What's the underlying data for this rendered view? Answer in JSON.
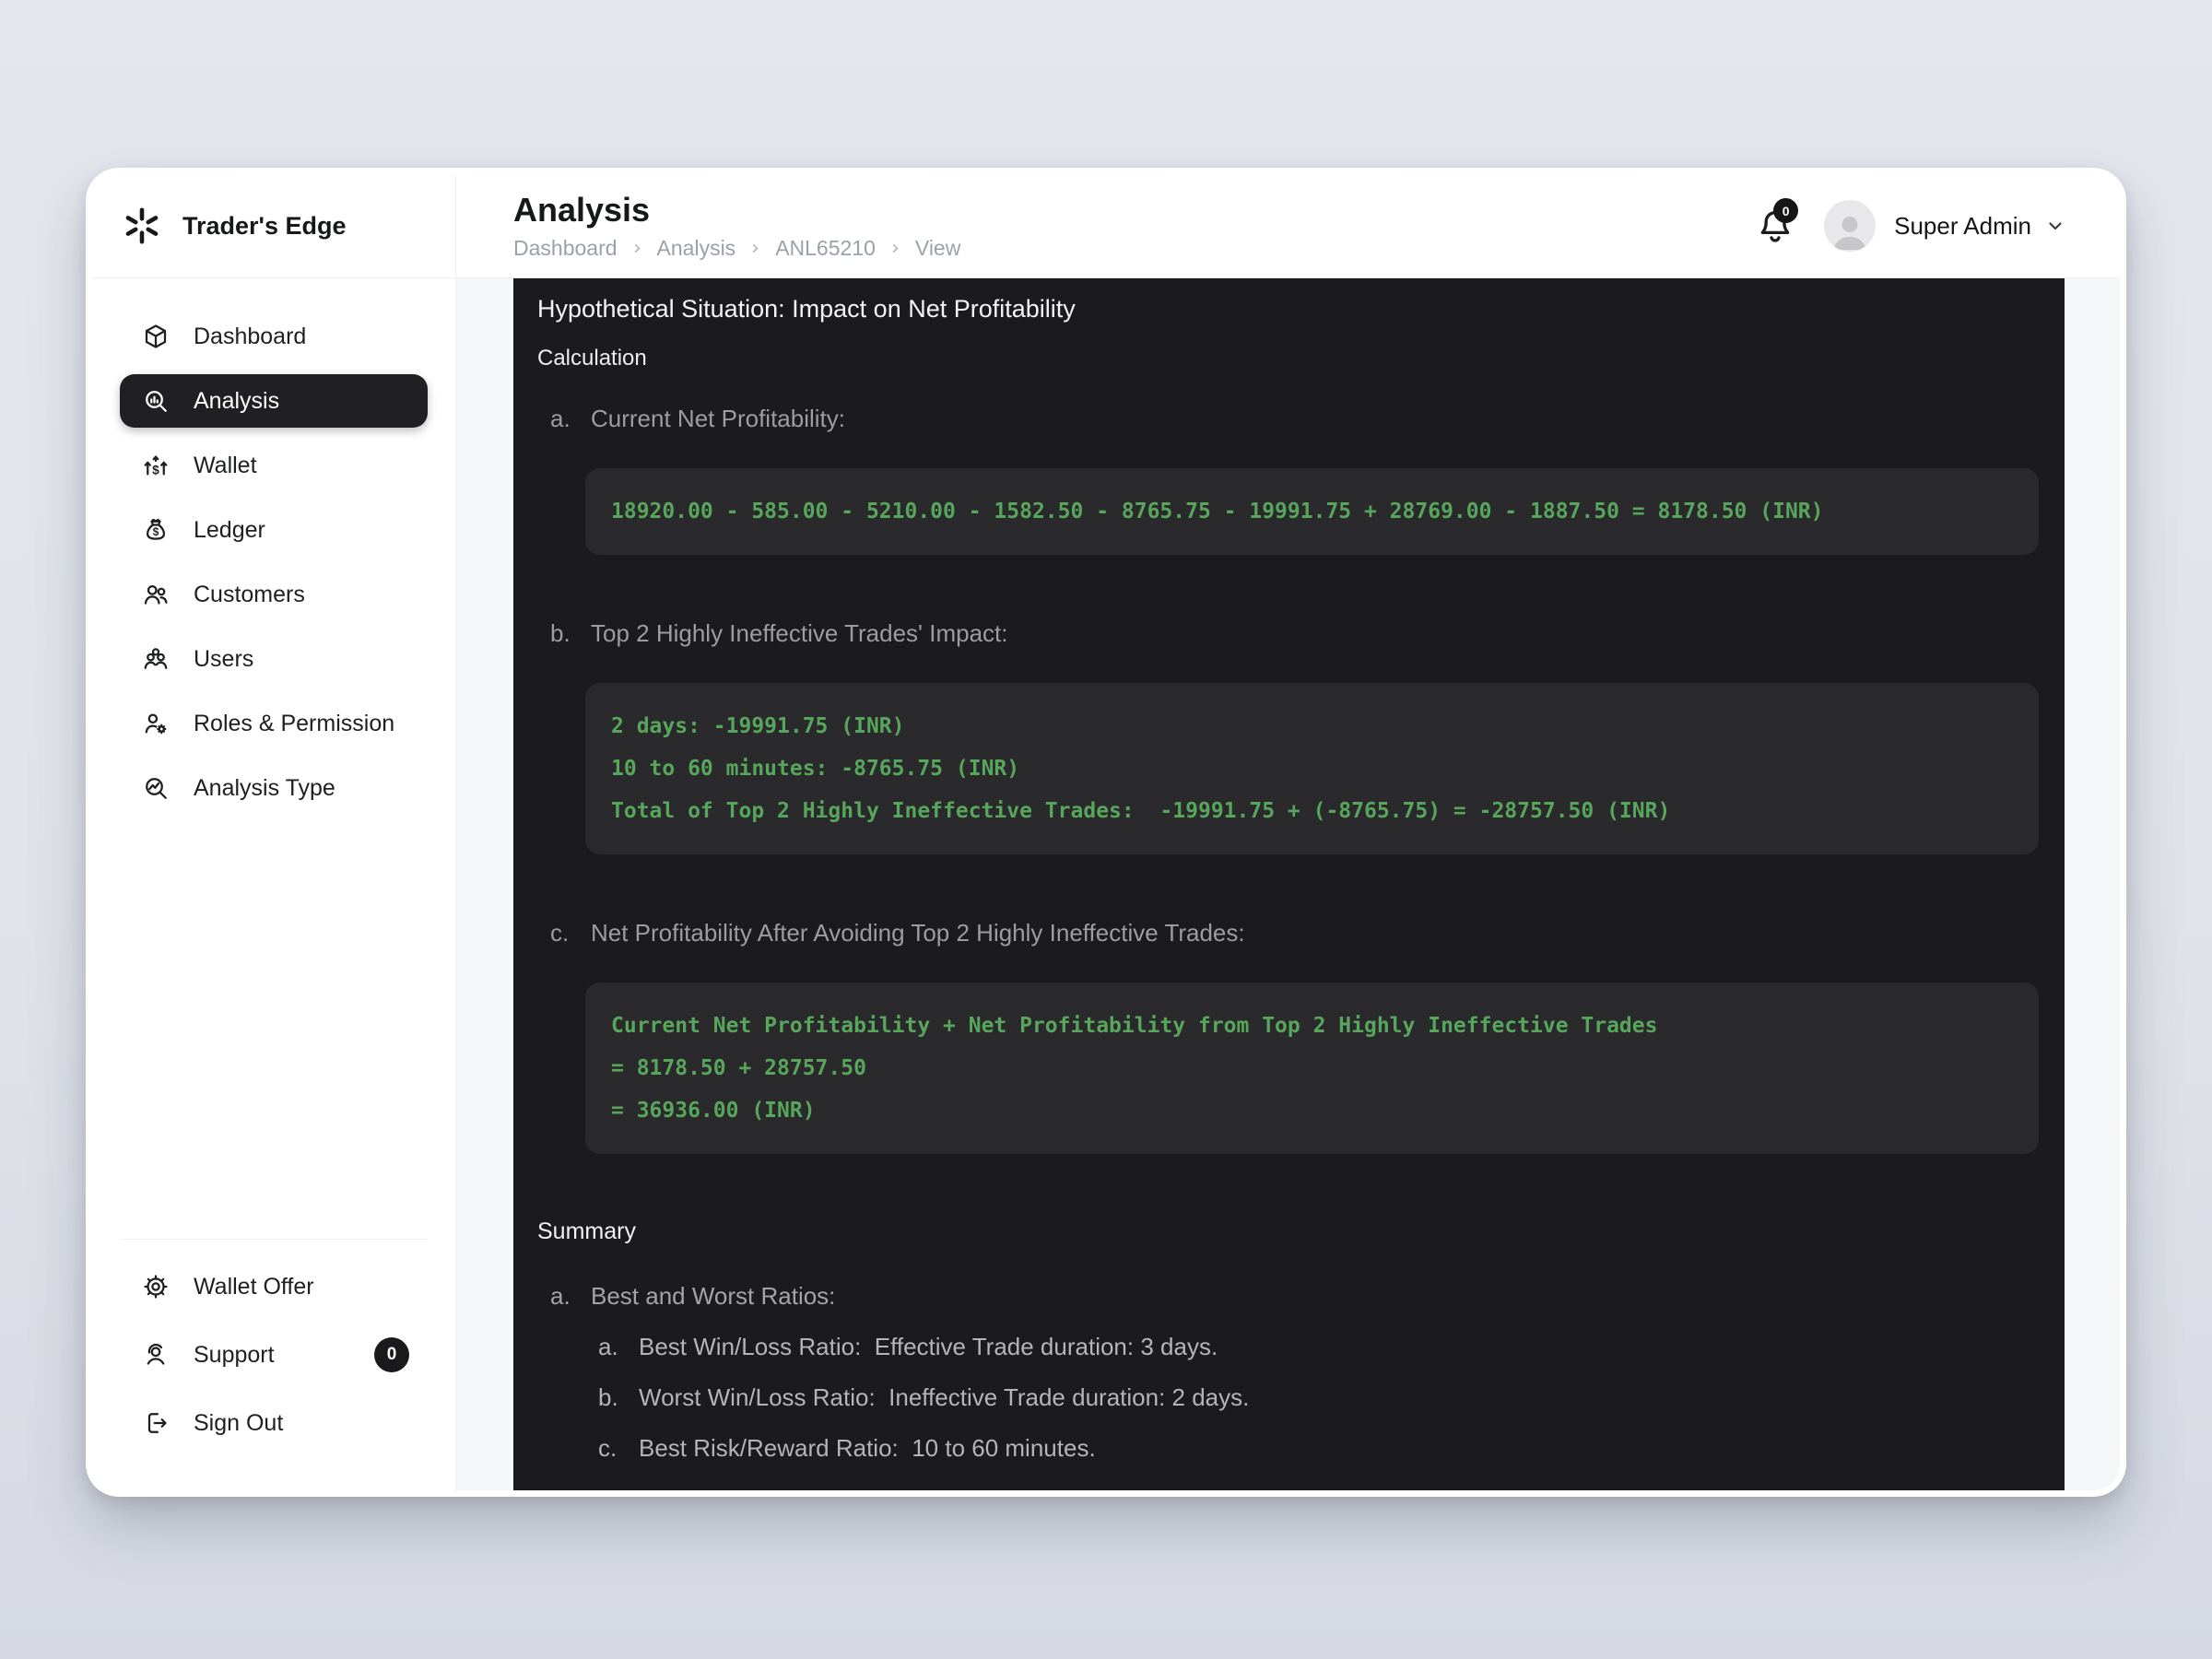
{
  "app": {
    "name": "Trader's Edge"
  },
  "colors": {
    "page_bg": "#e2e4eb",
    "panel_bg": "#1b1b1e",
    "code_block_bg": "#2a2a2d",
    "code_green": "#57a65c",
    "active_item_bg": "#202022",
    "badge_bg": "#1a1a1c"
  },
  "icons": {
    "logo": "spark-asterisk",
    "dashboard": "cube",
    "analysis": "magnifier-bar-chart",
    "wallet": "dollar-up-arrows",
    "ledger": "money-bag",
    "customers": "two-people",
    "users": "three-people",
    "roles": "person-gear",
    "analysis_type": "magnifier-trend",
    "wallet_offer": "gear",
    "support": "headset-person",
    "sign_out": "logout-arrow",
    "notifications": "bell",
    "user_menu": "chevron-down",
    "breadcrumb_sep": "chevron-right"
  },
  "header": {
    "title": "Analysis",
    "breadcrumb": [
      "Dashboard",
      "Analysis",
      "ANL65210",
      "View"
    ],
    "notification_badge": "0",
    "user_name": "Super Admin"
  },
  "sidebar": {
    "items": [
      {
        "label": "Dashboard"
      },
      {
        "label": "Analysis"
      },
      {
        "label": "Wallet"
      },
      {
        "label": "Ledger"
      },
      {
        "label": "Customers"
      },
      {
        "label": "Users"
      },
      {
        "label": "Roles & Permission"
      },
      {
        "label": "Analysis Type"
      }
    ],
    "footer": [
      {
        "label": "Wallet Offer"
      },
      {
        "label": "Support",
        "badge": "0"
      },
      {
        "label": "Sign Out"
      }
    ]
  },
  "main": {
    "title": "Hypothetical Situation: Impact on Net Profitability",
    "calculation_label": "Calculation",
    "calc": {
      "items": [
        {
          "marker": "a.",
          "label": "Current Net Profitability:",
          "code": [
            "18920.00 - 585.00 - 5210.00 - 1582.50 - 8765.75 - 19991.75 + 28769.00 - 1887.50 = 8178.50 (INR)"
          ]
        },
        {
          "marker": "b.",
          "label": "Top 2 Highly Ineffective Trades' Impact:",
          "code": [
            "2 days: -19991.75 (INR)",
            "10 to 60 minutes: -8765.75 (INR)",
            "Total of Top 2 Highly Ineffective Trades:  -19991.75 + (-8765.75) = -28757.50 (INR)"
          ]
        },
        {
          "marker": "c.",
          "label": "Net Profitability After Avoiding Top 2 Highly Ineffective Trades:",
          "code": [
            "Current Net Profitability + Net Profitability from Top 2 Highly Ineffective Trades",
            "= 8178.50 + 28757.50",
            "= 36936.00 (INR)"
          ]
        }
      ]
    },
    "summary": {
      "title": "Summary",
      "items": [
        {
          "marker": "a.",
          "label": "Best and Worst Ratios:",
          "children": [
            {
              "marker": "a.",
              "text": "Best Win/Loss Ratio:  Effective Trade duration: 3 days."
            },
            {
              "marker": "b.",
              "text": "Worst Win/Loss Ratio:  Ineffective Trade duration: 2 days."
            },
            {
              "marker": "c.",
              "text": "Best Risk/Reward Ratio:  10 to 60 minutes."
            }
          ]
        }
      ]
    }
  }
}
